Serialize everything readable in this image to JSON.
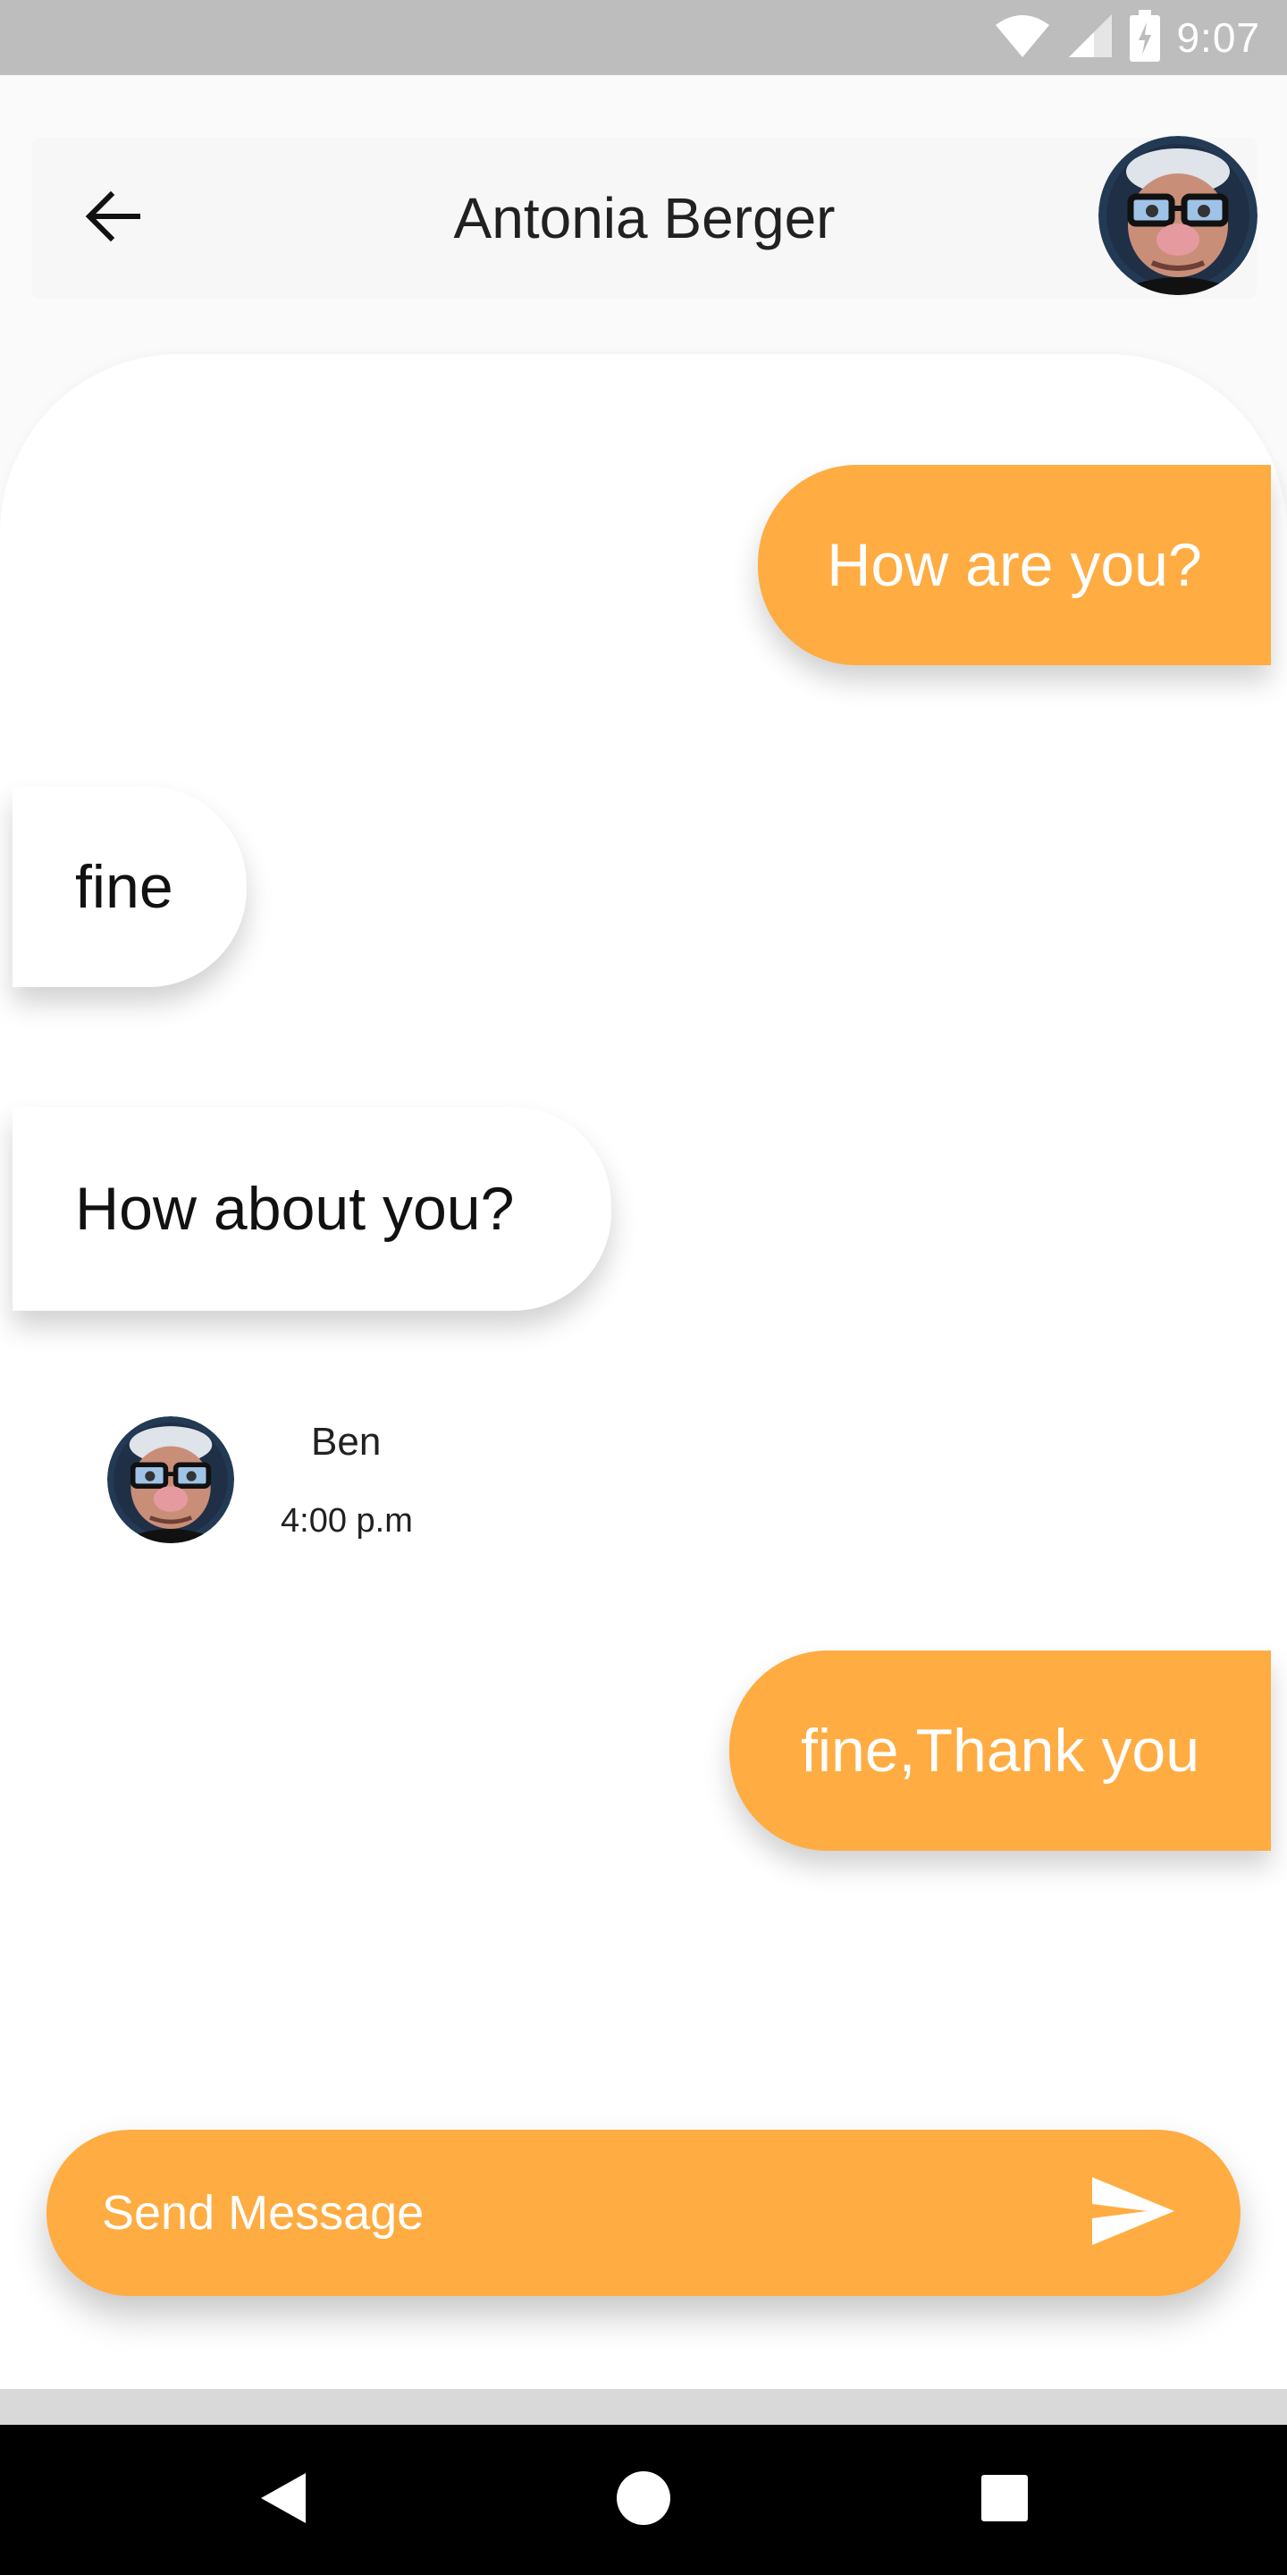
{
  "status_bar": {
    "time": "9:07",
    "icons": [
      "wifi-icon",
      "signal-icon",
      "battery-charging-icon"
    ]
  },
  "header": {
    "title": "Antonia Berger",
    "back_icon": "arrow-back-icon",
    "avatar": "contact-avatar"
  },
  "messages": [
    {
      "direction": "outgoing",
      "text": "How are you?"
    },
    {
      "direction": "incoming",
      "text": "fine"
    },
    {
      "direction": "incoming",
      "text": "How about you?"
    },
    {
      "direction": "outgoing",
      "text": "fine,Thank you"
    }
  ],
  "message_meta": {
    "name": "Ben",
    "time": "4:00 p.m"
  },
  "composer": {
    "placeholder": "Send Message",
    "value": "",
    "send_icon": "send-icon"
  },
  "colors": {
    "accent": "#ffac42",
    "status_bar": "#bdbdbd",
    "nav_bar": "#000000"
  },
  "nav_bar": {
    "icons": [
      "back-triangle-icon",
      "home-circle-icon",
      "recents-square-icon"
    ]
  }
}
